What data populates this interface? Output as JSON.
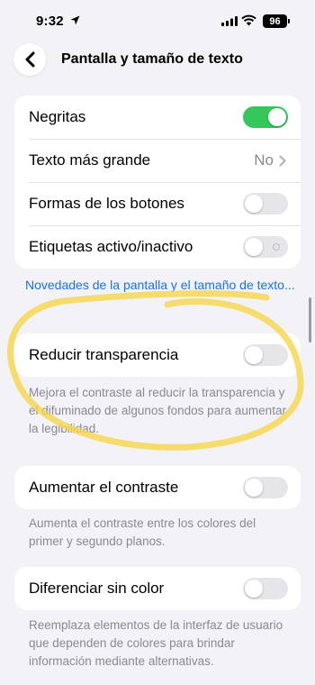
{
  "status": {
    "time": "9:32",
    "battery": "96"
  },
  "nav": {
    "title": "Pantalla y tamaño de texto"
  },
  "group1": {
    "bold_label": "Negritas",
    "larger_text_label": "Texto más grande",
    "larger_text_value": "No",
    "button_shapes_label": "Formas de los botones",
    "on_off_labels_label": "Etiquetas activo/inactivo"
  },
  "link_text": "Novedades de la pantalla y el tamaño de texto...",
  "reduce_transparency": {
    "label": "Reducir transparencia",
    "footnote": "Mejora el contraste al reducir la transparencia y el difuminado de algunos fondos para aumentar la legibilidad."
  },
  "increase_contrast": {
    "label": "Aumentar el contraste",
    "footnote": "Aumenta el contraste entre los colores del primer y segundo planos."
  },
  "differentiate": {
    "label": "Diferenciar sin color",
    "footnote": "Reemplaza elementos de la interfaz de usuario que dependen de colores para brindar información mediante alternativas."
  },
  "toggles": {
    "bold": true,
    "button_shapes": false,
    "on_off_labels": false,
    "reduce_transparency": false,
    "increase_contrast": false,
    "differentiate": false
  },
  "colors": {
    "toggle_on": "#34c759",
    "link": "#1a73e8",
    "highlight": "#f5d64a"
  }
}
